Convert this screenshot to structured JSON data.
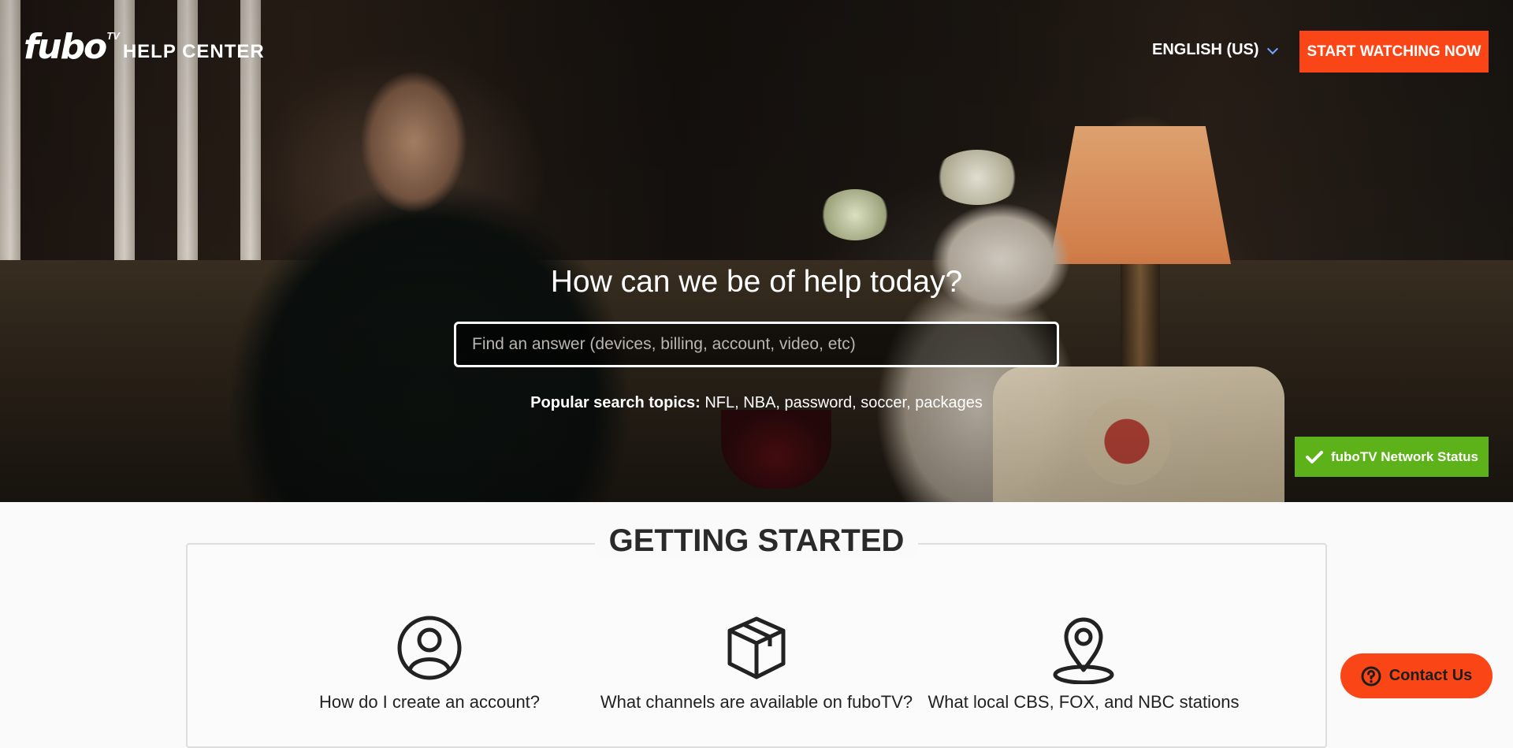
{
  "header": {
    "logo_text": "fubo",
    "logo_superscript": "TV",
    "help_center": "HELP CENTER",
    "language": "ENGLISH (US)",
    "cta": "START WATCHING NOW"
  },
  "hero": {
    "title": "How can we be of help today?",
    "search_placeholder": "Find an answer (devices, billing, account, video, etc)",
    "popular_label": "Popular search topics:",
    "topics": [
      "NFL",
      "NBA",
      "password",
      "soccer",
      "packages"
    ],
    "network_status": "fuboTV Network Status"
  },
  "getting_started": {
    "title": "GETTING STARTED",
    "cards": [
      {
        "label": "How do I create an account?",
        "icon": "user-circle-icon"
      },
      {
        "label": "What channels are available on fuboTV?",
        "icon": "box-icon"
      },
      {
        "label": "What local CBS, FOX, and NBC stations",
        "icon": "location-pin-icon"
      }
    ]
  },
  "contact": {
    "label": "Contact Us"
  },
  "colors": {
    "accent": "#fa4616",
    "status_green": "#5db21a",
    "chevron_blue": "#6fa8ff"
  }
}
